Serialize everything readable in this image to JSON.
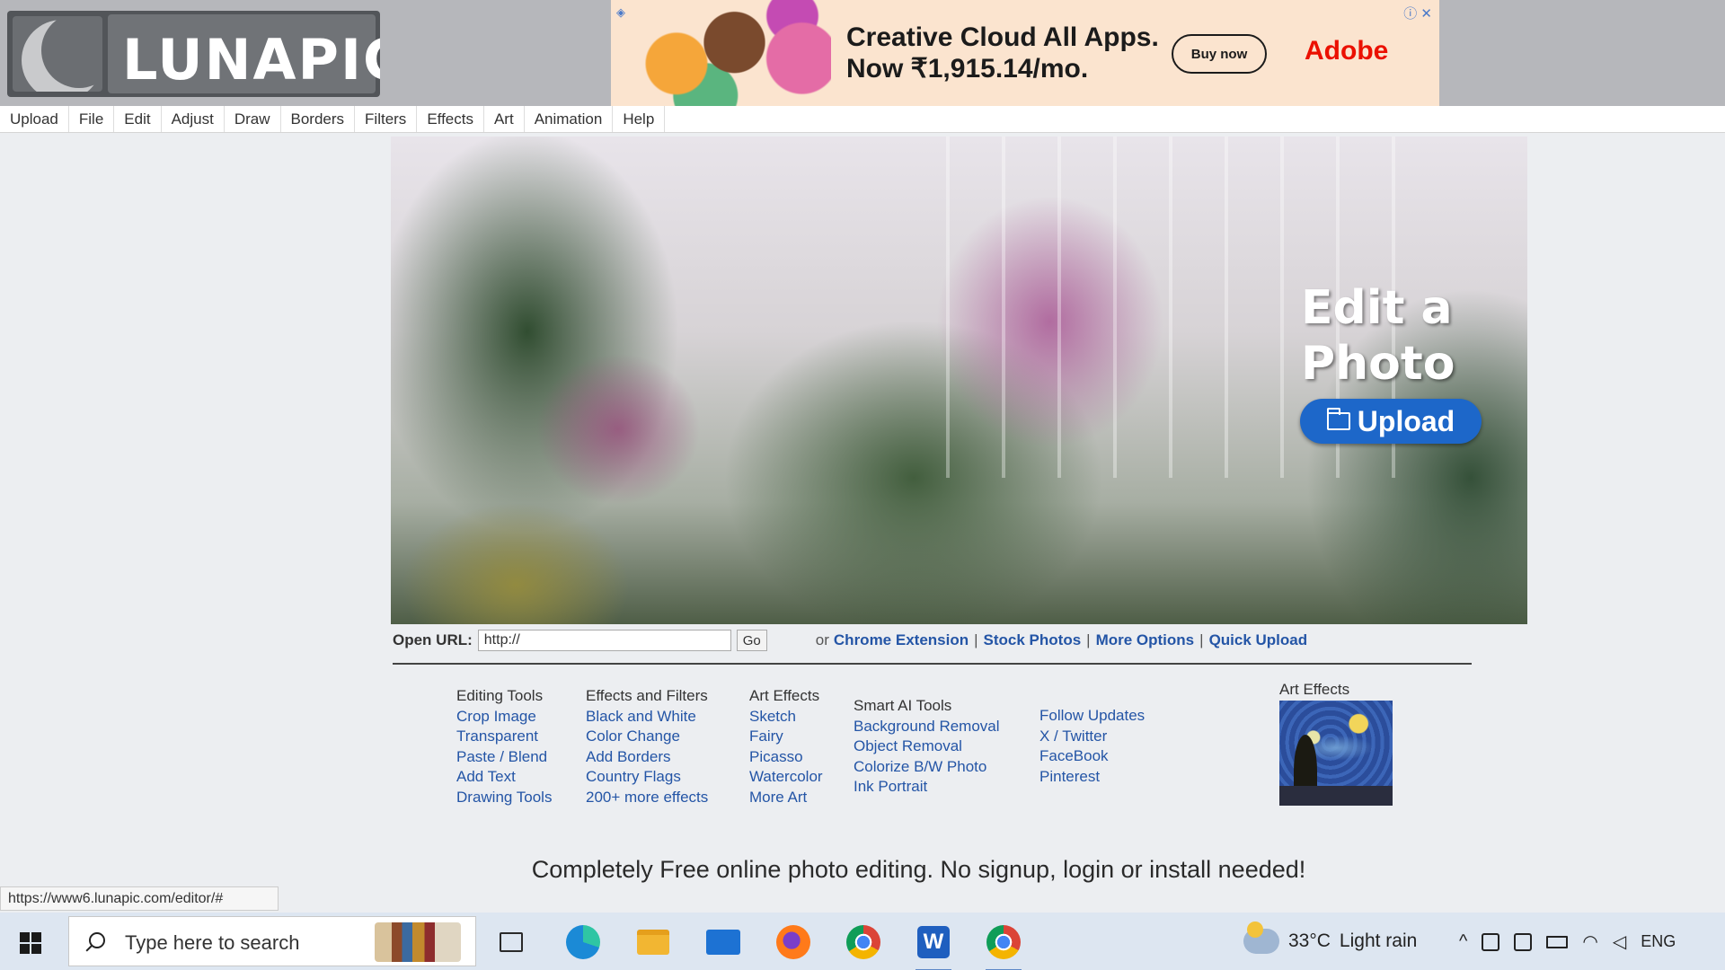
{
  "logo": {
    "text": "LUNAPIC"
  },
  "ad": {
    "headline_line1": "Creative Cloud All Apps.",
    "headline_line2": "Now ₹1,915.14/mo.",
    "button": "Buy now",
    "brand": "Adobe",
    "close": "ⓘ ✕"
  },
  "menu": {
    "items": [
      "Upload",
      "File",
      "Edit",
      "Adjust",
      "Draw",
      "Borders",
      "Filters",
      "Effects",
      "Art",
      "Animation",
      "Help"
    ]
  },
  "hero": {
    "title": "Edit a Photo",
    "upload_label": "Upload"
  },
  "url_bar": {
    "label": "Open URL:",
    "value": "http://",
    "go": "Go",
    "or": "or",
    "links": [
      "Chrome Extension",
      "Stock Photos",
      "More Options",
      "Quick Upload"
    ],
    "separator": "|"
  },
  "columns": {
    "editing": {
      "title": "Editing Tools",
      "links": [
        "Crop Image",
        "Transparent",
        "Paste / Blend",
        "Add Text",
        "Drawing Tools"
      ]
    },
    "effects": {
      "title": "Effects and Filters",
      "links": [
        "Black and White",
        "Color Change",
        "Add Borders",
        "Country Flags",
        "200+ more effects"
      ]
    },
    "art": {
      "title": "Art Effects",
      "links": [
        "Sketch",
        "Fairy",
        "Picasso",
        "Watercolor",
        "More Art"
      ]
    },
    "ai": {
      "title": "Smart AI Tools",
      "links": [
        "Background Removal",
        "Object Removal",
        "Colorize B/W Photo",
        "Ink Portrait"
      ]
    },
    "follow": {
      "links": [
        "Follow Updates",
        "X / Twitter",
        "FaceBook",
        "Pinterest"
      ]
    },
    "art_card": {
      "title": "Art Effects"
    }
  },
  "tagline": "Completely Free online photo editing. No signup, login or install needed!",
  "status_url": "https://www6.lunapic.com/editor/#",
  "taskbar": {
    "search_placeholder": "Type here to search",
    "weather_temp": "33°C",
    "weather_desc": "Light rain",
    "tray_chevron": "^",
    "language": "ENG",
    "apps": [
      {
        "name": "task-view-icon",
        "color": "#2a2a2a"
      },
      {
        "name": "edge-icon",
        "color": "#1b8ad6"
      },
      {
        "name": "file-explorer-icon",
        "color": "#f2b632"
      },
      {
        "name": "mail-icon",
        "color": "#1d72d3"
      },
      {
        "name": "firefox-icon",
        "color": "#ff7a1a"
      },
      {
        "name": "chrome-icon",
        "color": "#db4437"
      },
      {
        "name": "word-icon",
        "color": "#1f5fbf"
      },
      {
        "name": "chrome-profile-icon",
        "color": "#db4437"
      }
    ]
  }
}
